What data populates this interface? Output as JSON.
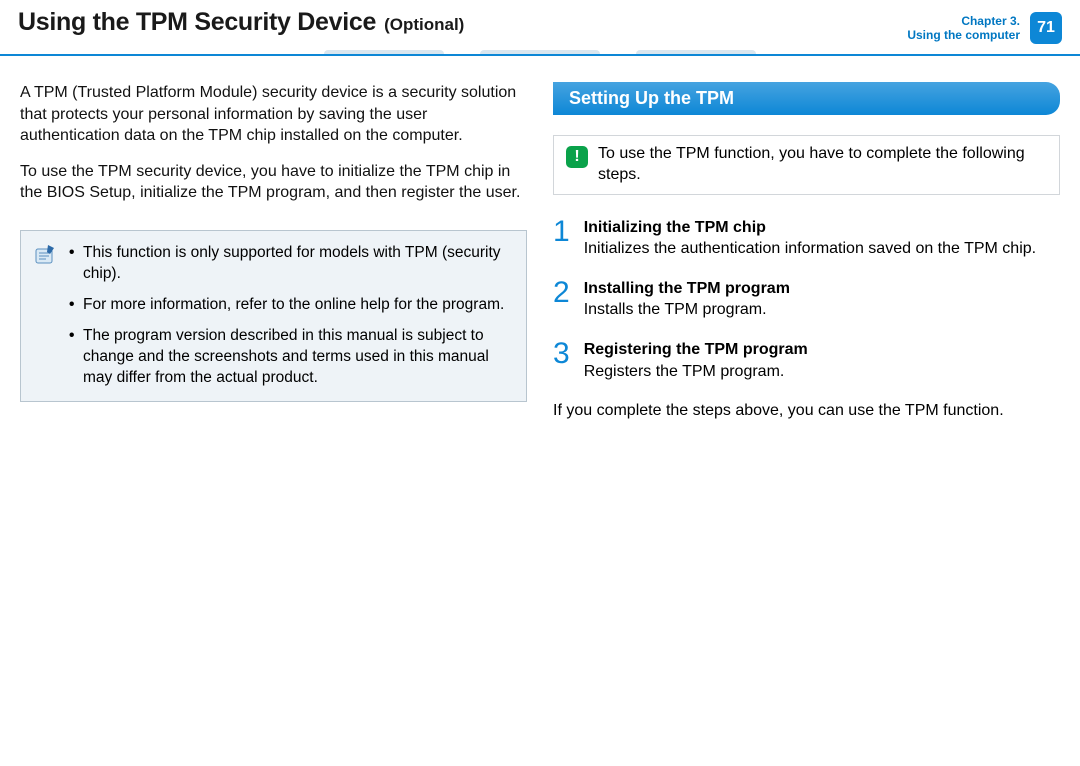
{
  "header": {
    "title_main": "Using the TPM Security Device",
    "title_optional": "(Optional)",
    "chapter_line1": "Chapter 3.",
    "chapter_line2": "Using the computer",
    "page_number": "71"
  },
  "left": {
    "p1": "A TPM (Trusted Platform Module) security device is a security solution that protects your personal information by saving the user authentication data on the TPM chip installed on the computer.",
    "p2": "To use the TPM security device, you have to initialize the TPM chip in the BIOS Setup, initialize the TPM program, and then register the user.",
    "notes": {
      "n1": "This function is only supported for models with TPM (security chip).",
      "n2": "For more information, refer to the online help for the program.",
      "n3": "The program version described in this manual is subject to change and the screenshots and terms used in this manual may differ from the actual product."
    }
  },
  "right": {
    "section_title": "Setting Up the TPM",
    "alert_text": "To use the TPM function, you have to complete the following steps.",
    "alert_symbol": "!",
    "steps": {
      "s1": {
        "num": "1",
        "title": "Initializing the TPM chip",
        "desc": "Initializes the authentication information saved on the TPM chip."
      },
      "s2": {
        "num": "2",
        "title": "Installing the TPM program",
        "desc": "Installs the TPM program."
      },
      "s3": {
        "num": "3",
        "title": "Registering the TPM program",
        "desc": "Registers the TPM program."
      }
    },
    "closing": "If you complete the steps above, you can use the TPM function."
  }
}
